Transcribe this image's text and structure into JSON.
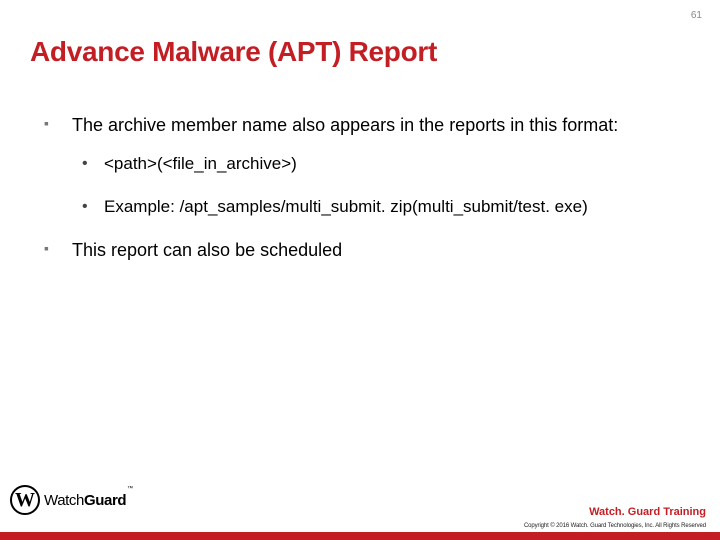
{
  "page_number": "61",
  "title": "Advance Malware (APT) Report",
  "bullets": {
    "b1": "The archive member name also appears in the reports in this format:",
    "b1_sub1": "<path>(<file_in_archive>)",
    "b1_sub2": "Example: /apt_samples/multi_submit. zip(multi_submit/test. exe)",
    "b2": "This report can also be scheduled"
  },
  "logo": {
    "mark_letter": "W",
    "brand_part1": "Watch",
    "brand_part2": "Guard",
    "tm": "™"
  },
  "footer": {
    "training_label": "Watch. Guard Training",
    "copyright": "Copyright © 2016 Watch. Guard Technologies, Inc. All Rights Reserved"
  }
}
